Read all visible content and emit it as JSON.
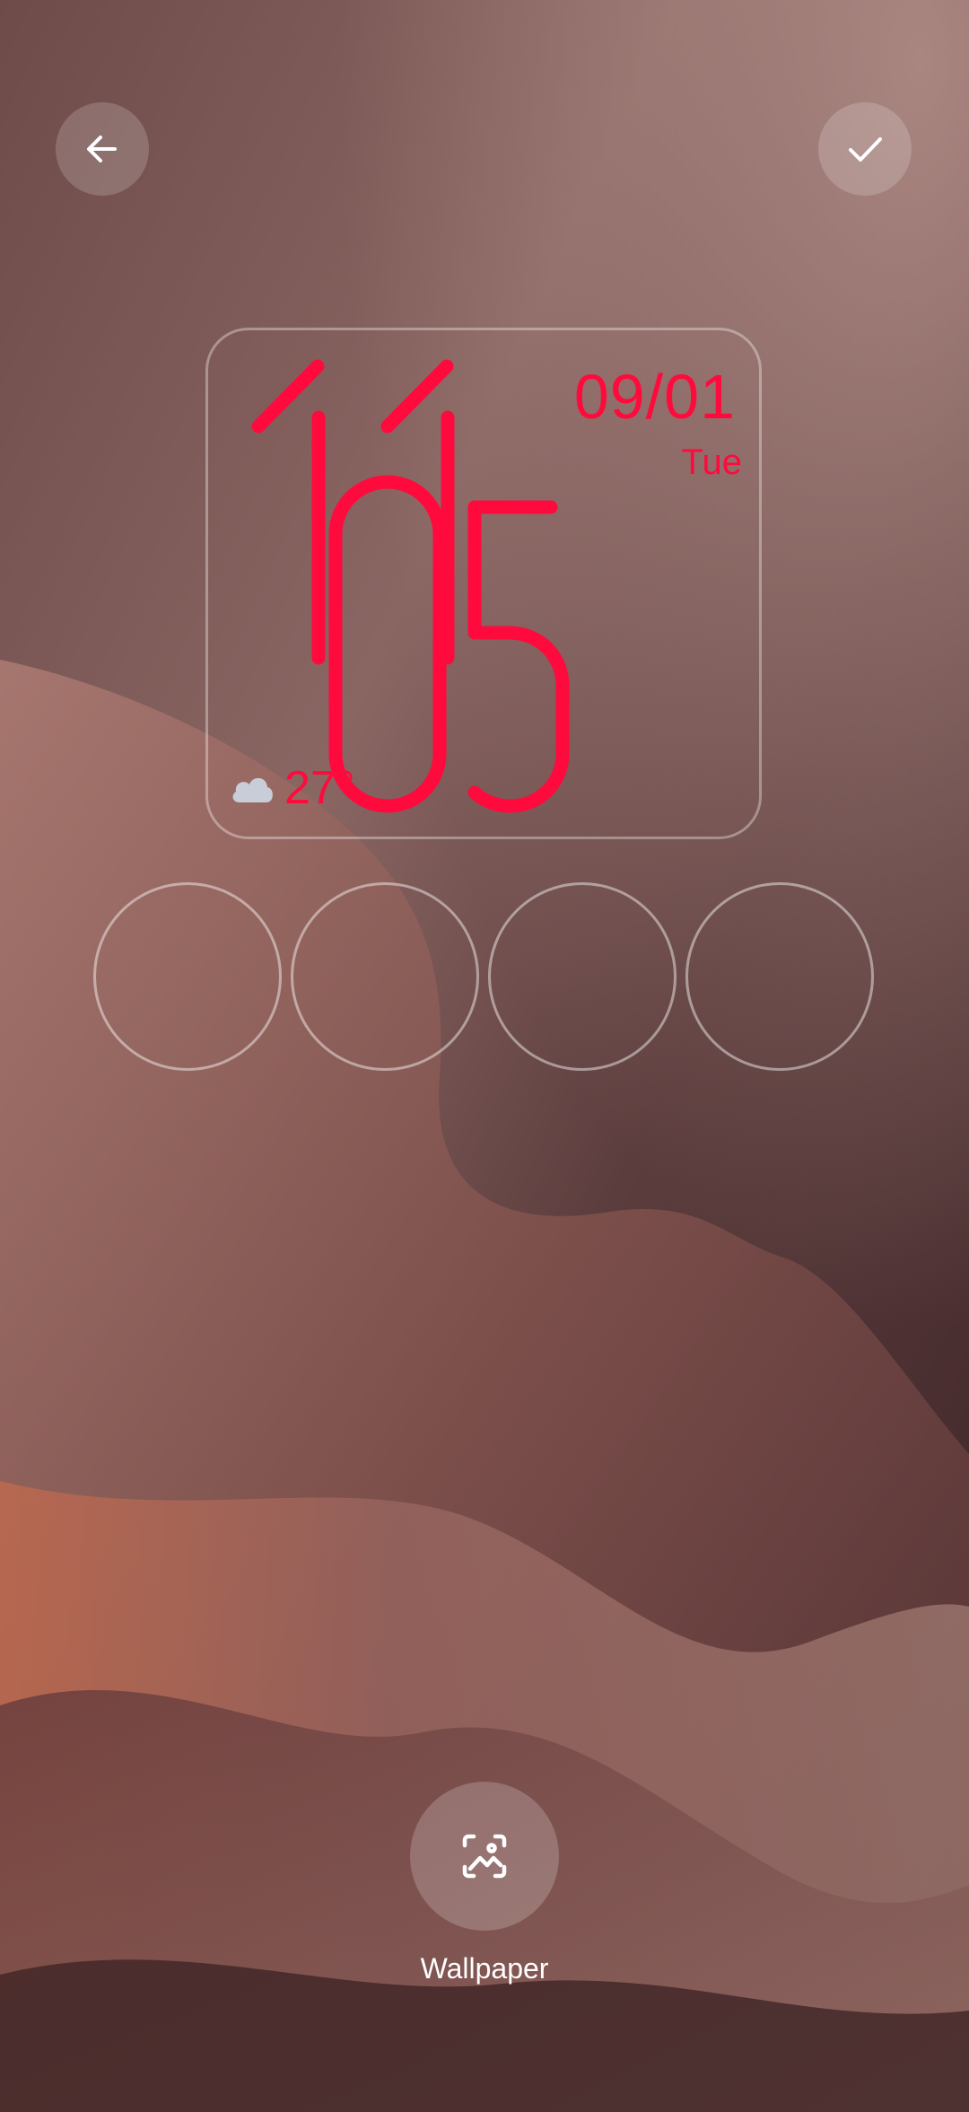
{
  "clock": {
    "hour": "11",
    "minute": "05",
    "date": "09/01",
    "day": "Tue"
  },
  "weather": {
    "temperature": "27°",
    "icon": "cloud-icon"
  },
  "toolbar": {
    "back_icon": "arrow-left-icon",
    "confirm_icon": "checkmark-icon"
  },
  "shortcuts": {
    "count": 4
  },
  "bottom": {
    "wallpaper_label": "Wallpaper",
    "wallpaper_icon": "image-edit-icon"
  },
  "colors": {
    "clock_accent": "#ff0a3c",
    "button_bg": "rgba(255,255,255,0.18)"
  }
}
